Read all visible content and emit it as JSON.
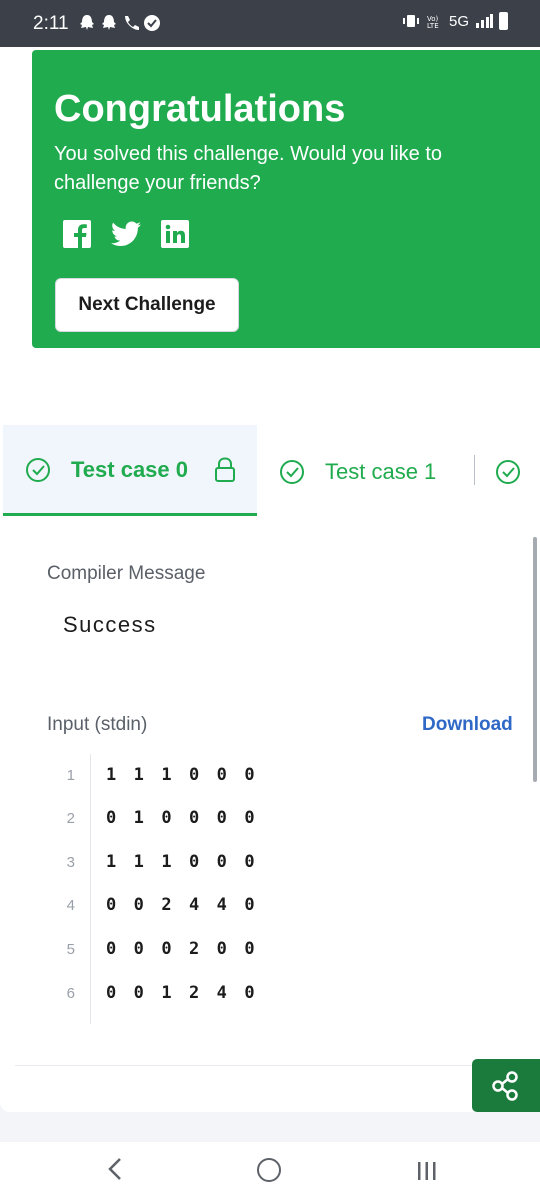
{
  "status_bar": {
    "time": "2:11",
    "network": "5G"
  },
  "banner": {
    "title": "Congratulations",
    "message": "You solved this challenge. Would you like to challenge your friends?",
    "social_icons": [
      "facebook-icon",
      "twitter-icon",
      "linkedin-icon"
    ],
    "next_button_label": "Next Challenge",
    "background_color": "#1fab4e"
  },
  "tabs": [
    {
      "label": "Test case 0",
      "status": "passed",
      "locked": true,
      "selected": true
    },
    {
      "label": "Test case 1",
      "status": "passed",
      "locked": false,
      "selected": false
    },
    {
      "label": "",
      "status": "passed",
      "locked": false,
      "selected": false
    }
  ],
  "result": {
    "compiler_label": "Compiler Message",
    "compiler_message": "Success",
    "input_label": "Input (stdin)",
    "download_label": "Download"
  },
  "input_lines": [
    {
      "number": "1",
      "text": "1 1 1 0 0 0"
    },
    {
      "number": "2",
      "text": "0 1 0 0 0 0"
    },
    {
      "number": "3",
      "text": "1 1 1 0 0 0"
    },
    {
      "number": "4",
      "text": "0 0 2 4 4 0"
    },
    {
      "number": "5",
      "text": "0 0 0 2 0 0"
    },
    {
      "number": "6",
      "text": "0 0 1 2 4 0"
    }
  ],
  "colors": {
    "accent_green": "#1fab4e",
    "link_blue": "#2f68c6",
    "share_button": "#1b7b3d"
  }
}
